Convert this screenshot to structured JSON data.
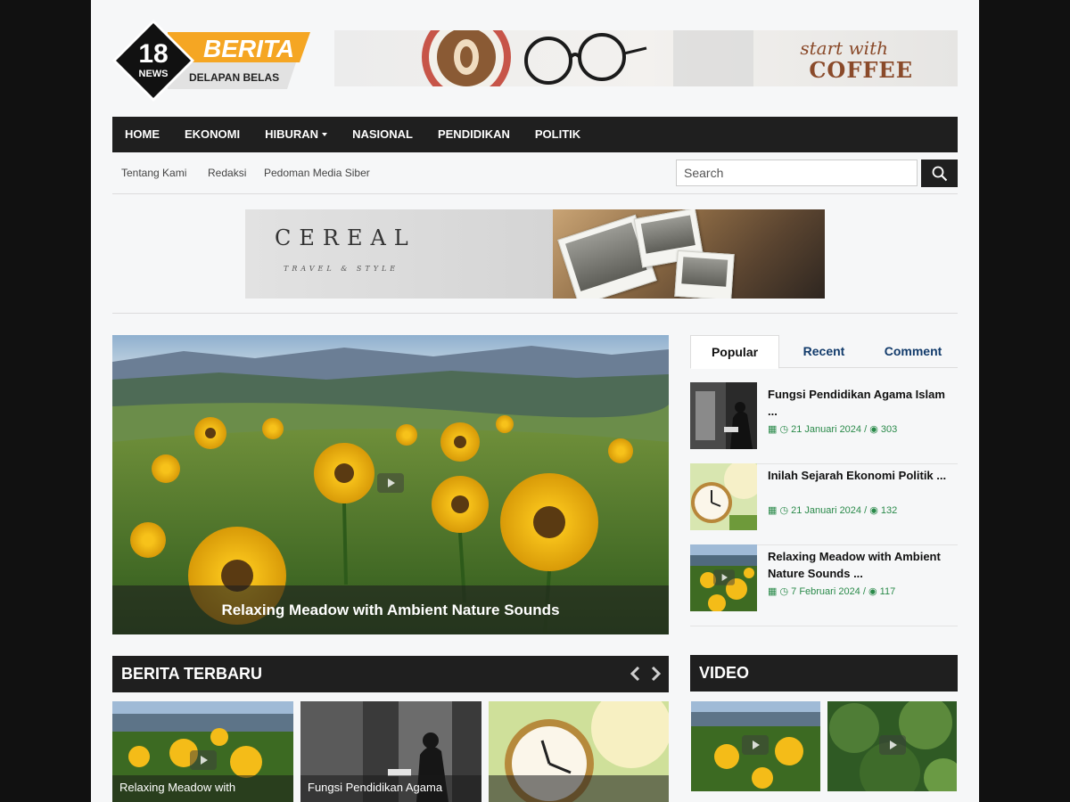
{
  "brand": {
    "number": "18",
    "news": "NEWS",
    "name": "BERITA",
    "tagline": "DELAPAN BELAS"
  },
  "top_banner": {
    "line1": "start with",
    "line2": "COFFEE"
  },
  "nav": {
    "items": [
      {
        "label": "HOME"
      },
      {
        "label": "EKONOMI"
      },
      {
        "label": "HIBURAN"
      },
      {
        "label": "NASIONAL"
      },
      {
        "label": "PENDIDIKAN"
      },
      {
        "label": "POLITIK"
      }
    ]
  },
  "subnav": {
    "links": [
      {
        "label": "Tentang Kami"
      },
      {
        "label": "Redaksi"
      },
      {
        "label": "Pedoman Media Siber"
      }
    ],
    "search_placeholder": "Search"
  },
  "mid_banner": {
    "brand": "CEREAL",
    "tagline": "TRAVEL & STYLE"
  },
  "featured": {
    "title": "Relaxing Meadow with Ambient Nature Sounds"
  },
  "tabs": {
    "items": [
      {
        "label": "Popular"
      },
      {
        "label": "Recent"
      },
      {
        "label": "Comment"
      }
    ],
    "active": "Popular"
  },
  "popular_posts": [
    {
      "title": "Fungsi Pendidikan Agama Islam ...",
      "date": "21 Januari 2024",
      "views": "303"
    },
    {
      "title": "Inilah Sejarah Ekonomi Politik ...",
      "date": "21 Januari 2024",
      "views": "132"
    },
    {
      "title": "Relaxing Meadow with Ambient Nature Sounds ...",
      "date": "7 Februari 2024",
      "views": "117"
    }
  ],
  "latest": {
    "heading": "BERITA TERBARU",
    "cards": [
      {
        "caption": "Relaxing Meadow with"
      },
      {
        "caption": "Fungsi Pendidikan Agama"
      },
      {
        "caption": ""
      }
    ]
  },
  "video": {
    "heading": "VIDEO"
  },
  "colors": {
    "dark": "#1f1f1f",
    "accent": "#f5a623",
    "meta_green": "#2a8a4a",
    "tab_blue": "#123b6b"
  }
}
